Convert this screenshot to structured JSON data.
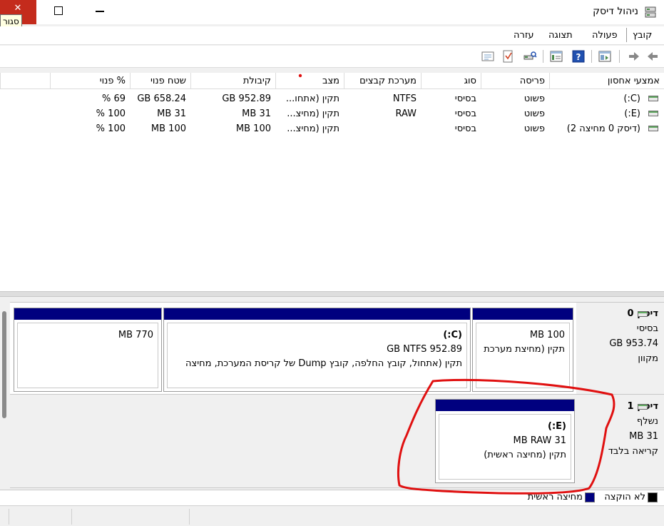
{
  "window": {
    "title": "ניהול דיסק",
    "close_tooltip": "סגור"
  },
  "menu": [
    "קובץ",
    "פעולה",
    "תצוגה",
    "עזרה"
  ],
  "toolbar": {
    "icons": [
      "back-icon",
      "forward-icon",
      "console-tree-icon",
      "help-icon",
      "properties-icon",
      "connect-icon",
      "rescan-icon",
      "refresh-icon"
    ]
  },
  "volume_list": {
    "columns": [
      "אמצעי אחסון",
      "פריסה",
      "סוג",
      "מערכת קבצים",
      "מצב",
      "קיבולת",
      "שטח פנוי",
      "% פנוי"
    ],
    "rows": [
      {
        "volume": "(C:)",
        "layout": "פשוט",
        "type": "בסיסי",
        "fs": "NTFS",
        "status": "תקין (אתחו...",
        "capacity": "952.89 GB",
        "free": "658.24 GB",
        "pct": "69 %"
      },
      {
        "volume": "(E:)",
        "layout": "פשוט",
        "type": "בסיסי",
        "fs": "RAW",
        "status": "תקין (מחיצ...",
        "capacity": "31 MB",
        "free": "31 MB",
        "pct": "100 %"
      },
      {
        "volume": "(דיסק 0 מחיצה 2)",
        "layout": "פשוט",
        "type": "בסיסי",
        "fs": "",
        "status": "תקין (מחיצ...",
        "capacity": "100 MB",
        "free": "100 MB",
        "pct": "100 %"
      }
    ]
  },
  "disks": [
    {
      "name": "דיסק 0",
      "type": "בסיסי",
      "size": "953.74 GB",
      "state": "מקוון",
      "partitions": [
        {
          "label": "",
          "line1": "100 MB",
          "line2": "תקין (מחיצת מערכת"
        },
        {
          "label": "(C:)",
          "line1": "952.89 GB NTFS",
          "line2": "תקין (אתחול, קובץ החלפה, קובץ Dump של קריסת המערכת, מחיצה"
        },
        {
          "label": "",
          "line1": "770 MB",
          "line2": ""
        }
      ]
    },
    {
      "name": "דיסק 1",
      "type": "נשלף",
      "size": "31 MB",
      "state": "קריאה בלבד",
      "partitions": [
        {
          "label": "(E:)",
          "line1": "31 MB RAW",
          "line2": "תקין (מחיצה ראשית)"
        }
      ]
    }
  ],
  "legend": [
    {
      "label": "לא הוקצה",
      "color": "#000000"
    },
    {
      "label": "מחיצה ראשית",
      "color": "#00007f"
    }
  ],
  "annotation_color": "#e01010"
}
